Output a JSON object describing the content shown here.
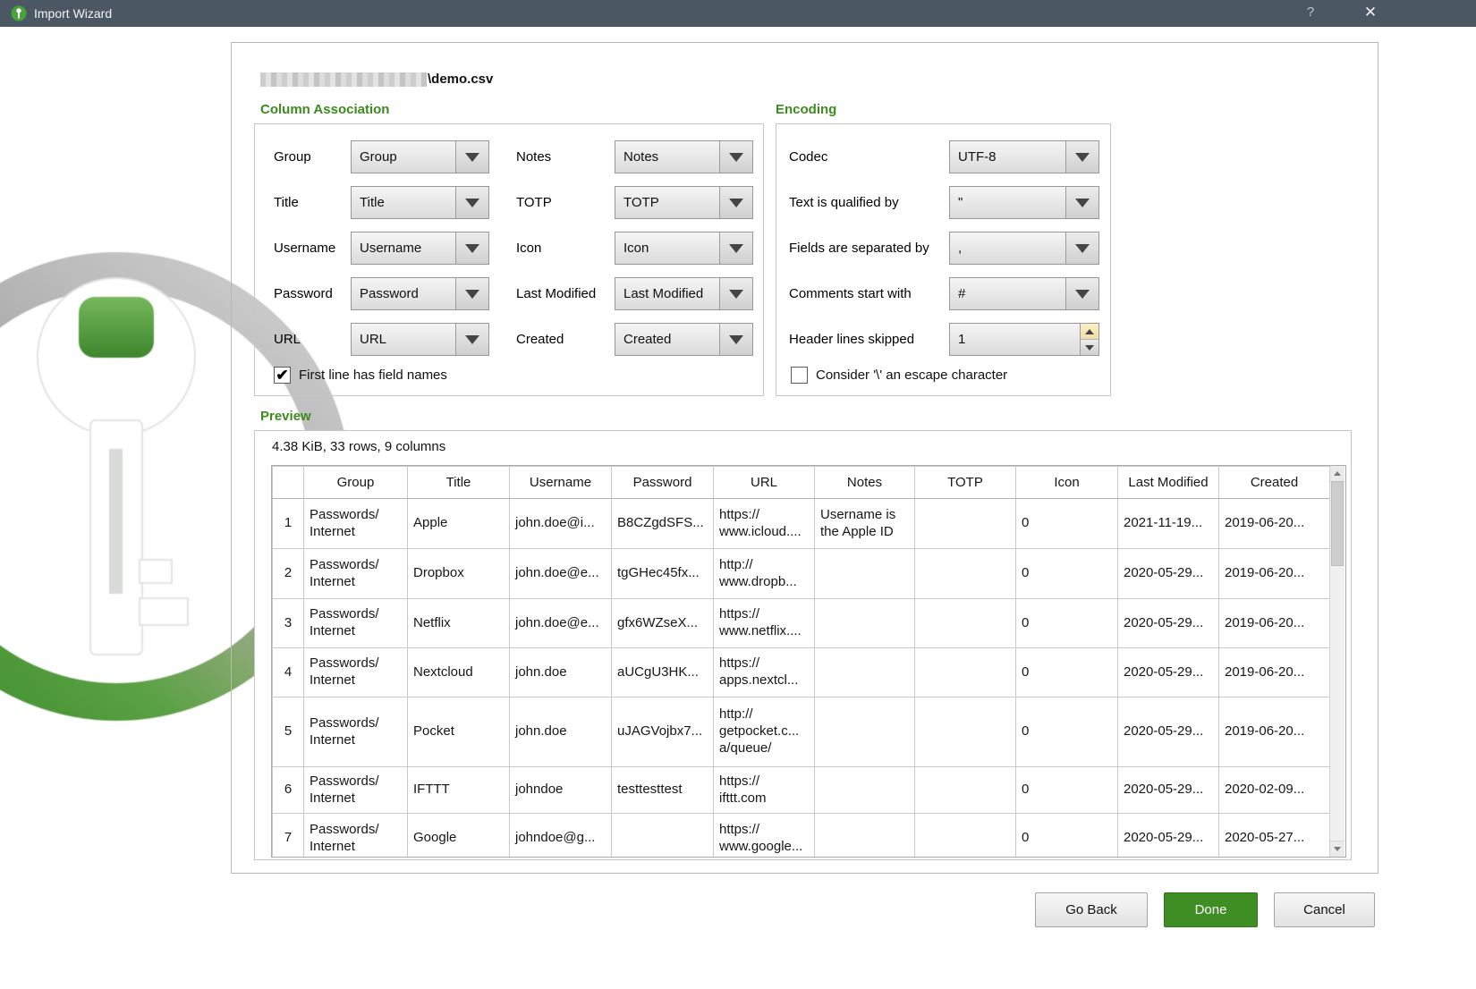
{
  "window": {
    "title": "Import Wizard",
    "help": "?",
    "close": "✕"
  },
  "file": {
    "name": "\\demo.csv",
    "path_censored": true
  },
  "column_association": {
    "heading": "Column Association",
    "left": [
      {
        "label": "Group",
        "value": "Group"
      },
      {
        "label": "Title",
        "value": "Title"
      },
      {
        "label": "Username",
        "value": "Username"
      },
      {
        "label": "Password",
        "value": "Password"
      },
      {
        "label": "URL",
        "value": "URL"
      }
    ],
    "right": [
      {
        "label": "Notes",
        "value": "Notes"
      },
      {
        "label": "TOTP",
        "value": "TOTP"
      },
      {
        "label": "Icon",
        "value": "Icon"
      },
      {
        "label": "Last Modified",
        "value": "Last Modified"
      },
      {
        "label": "Created",
        "value": "Created"
      }
    ],
    "checkbox": {
      "label": "First line has field names",
      "checked": true
    }
  },
  "encoding": {
    "heading": "Encoding",
    "selects": [
      {
        "label": "Codec",
        "value": "UTF-8"
      },
      {
        "label": "Text is qualified by",
        "value": "\""
      },
      {
        "label": "Fields are separated by",
        "value": ","
      },
      {
        "label": "Comments start with",
        "value": "#"
      }
    ],
    "spinbox": {
      "label": "Header lines skipped",
      "value": "1"
    },
    "checkbox": {
      "label": "Consider '\\' an escape character",
      "checked": false
    }
  },
  "preview": {
    "heading": "Preview",
    "summary": "4.38 KiB, 33 rows, 9 columns",
    "headers": [
      "",
      "Group",
      "Title",
      "Username",
      "Password",
      "URL",
      "Notes",
      "TOTP",
      "Icon",
      "Last Modified",
      "Created"
    ],
    "rows": [
      [
        "1",
        "Passwords/\nInternet",
        "Apple",
        "john.doe@i...",
        "B8CZgdSFS...",
        "https://\nwww.icloud....",
        "Username is\nthe Apple ID",
        "",
        "0",
        "2021-11-19...",
        "2019-06-20..."
      ],
      [
        "2",
        "Passwords/\nInternet",
        "Dropbox",
        "john.doe@e...",
        "tgGHec45fx...",
        "http://\nwww.dropb...",
        "",
        "",
        "0",
        "2020-05-29...",
        "2019-06-20..."
      ],
      [
        "3",
        "Passwords/\nInternet",
        "Netflix",
        "john.doe@e...",
        "gfx6WZseX...",
        "https://\nwww.netflix....",
        "",
        "",
        "0",
        "2020-05-29...",
        "2019-06-20..."
      ],
      [
        "4",
        "Passwords/\nInternet",
        "Nextcloud",
        "john.doe",
        "aUCgU3HK...",
        "https://\napps.nextcl...",
        "",
        "",
        "0",
        "2020-05-29...",
        "2019-06-20..."
      ],
      [
        "5",
        "Passwords/\nInternet",
        "Pocket",
        "john.doe",
        "uJAGVojbx7...",
        "http://\ngetpocket.c...\na/queue/",
        "",
        "",
        "0",
        "2020-05-29...",
        "2019-06-20..."
      ],
      [
        "6",
        "Passwords/\nInternet",
        "IFTTT",
        "johndoe",
        "testtesttest",
        "https://\nifttt.com",
        "",
        "",
        "0",
        "2020-05-29...",
        "2020-02-09..."
      ],
      [
        "7",
        "Passwords/\nInternet",
        "Google",
        "johndoe@g...",
        "",
        "https://\nwww.google...",
        "",
        "",
        "0",
        "2020-05-29...",
        "2020-05-27..."
      ]
    ]
  },
  "buttons": {
    "go_back": "Go Back",
    "done": "Done",
    "cancel": "Cancel"
  },
  "icons": {
    "app": "keepassxc-logo",
    "dropdown_arrow": "chevron-down",
    "watermark": "keepassxc-key-logo"
  },
  "colors": {
    "titlebar": "#4b5763",
    "heading_green": "#3d8b1e",
    "done_button_green": "#3e8e24"
  }
}
